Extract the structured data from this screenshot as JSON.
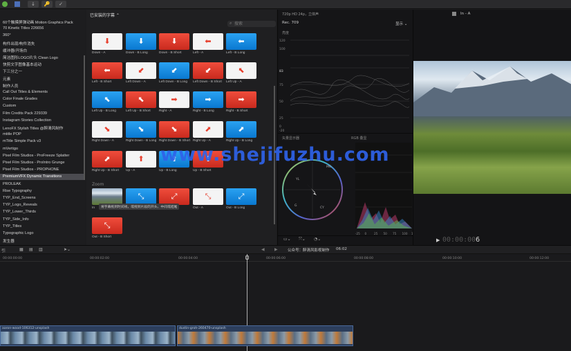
{
  "topbar": {
    "buttons": [
      "↓",
      "🔑",
      "✓"
    ]
  },
  "sidebar": {
    "items": [
      "60个触摸屏弹动画 Motion Graphics Pack",
      "70 Kinetic Titles 226656",
      "360°",
      "构件出现/构件消失",
      "缓冲器/开场白",
      "简洁图形LOGO片头 Clean Logo",
      "快剪文字图像基本运动",
      "下三分之一",
      "元素",
      "制作人员",
      "Call Out Titles & Elements",
      "Color Finale Grades",
      "Custom",
      "Film Credits Pack 229339",
      "Instagram Stories Collection",
      "LenoFX Stylish Titles @醉清风制作",
      "mtitle POP",
      "mTitle Simple Pack v3",
      "mVertigo",
      "Pixel Film Studios - ProFreeze Splatter",
      "Pixel Film Studios - ProIntro Grunge",
      "Pixel Film Studios - PROPHONE",
      "PremiumVFX Dynamic Transitions",
      "PROLEAK",
      "Rise Typography",
      "TYP_End_Screens",
      "TYP_Logo_Reveals",
      "TYP_Lower_Thirds",
      "TYP_Side_Info",
      "TYP_Titles",
      "Typographic Logo",
      "发生器"
    ],
    "selected_index": 22
  },
  "browser": {
    "header": "已安装的字幕 ⌃",
    "search_placeholder": "搜索",
    "section_zoom": "Zoom",
    "tooltip": "将字幕拖到时间线，或拖到片段的开头、中间或结尾",
    "items": [
      {
        "label": "Down - A",
        "style": "white",
        "glyph": "⬇",
        "gc": "#e8402e"
      },
      {
        "label": "Down - B Long",
        "style": "blue",
        "glyph": "⬇",
        "gc": "#fff"
      },
      {
        "label": "Down - B Short",
        "style": "red",
        "glyph": "⬇",
        "gc": "#fff"
      },
      {
        "label": "Left - A",
        "style": "white",
        "glyph": "⬅",
        "gc": "#e8402e"
      },
      {
        "label": "Left - B Long",
        "style": "blue",
        "glyph": "⬅",
        "gc": "#fff"
      },
      {
        "label": "Left - B Short",
        "style": "red",
        "glyph": "⬅",
        "gc": "#fff"
      },
      {
        "label": "Left Down - A",
        "style": "white",
        "glyph": "⬋",
        "gc": "#e8402e"
      },
      {
        "label": "Left Down - B Long",
        "style": "blue",
        "glyph": "⬋",
        "gc": "#fff"
      },
      {
        "label": "Left Down - B Short",
        "style": "red",
        "glyph": "⬋",
        "gc": "#fff"
      },
      {
        "label": "Left Up - A",
        "style": "white",
        "glyph": "⬉",
        "gc": "#e8402e"
      },
      {
        "label": "Left Up - B Long",
        "style": "blue",
        "glyph": "⬉",
        "gc": "#fff"
      },
      {
        "label": "Left Up - B Short",
        "style": "red",
        "glyph": "⬉",
        "gc": "#fff"
      },
      {
        "label": "Right - A",
        "style": "white",
        "glyph": "➡",
        "gc": "#e8402e"
      },
      {
        "label": "Right - B Long",
        "style": "blue",
        "glyph": "➡",
        "gc": "#fff"
      },
      {
        "label": "Right - B Short",
        "style": "red",
        "glyph": "➡",
        "gc": "#fff"
      },
      {
        "label": "Right Down - A",
        "style": "white",
        "glyph": "⬊",
        "gc": "#e8402e"
      },
      {
        "label": "Right Down - B Long",
        "style": "blue",
        "glyph": "⬊",
        "gc": "#fff"
      },
      {
        "label": "Right Down - B Short",
        "style": "red",
        "glyph": "⬊",
        "gc": "#fff"
      },
      {
        "label": "Right Up - A",
        "style": "white",
        "glyph": "⬈",
        "gc": "#e8402e"
      },
      {
        "label": "Right Up - B Long",
        "style": "blue",
        "glyph": "⬈",
        "gc": "#fff"
      },
      {
        "label": "Right Up - B Short",
        "style": "red",
        "glyph": "⬈",
        "gc": "#fff"
      },
      {
        "label": "Up - A",
        "style": "white",
        "glyph": "⬆",
        "gc": "#e8402e"
      },
      {
        "label": "Up - B Long",
        "style": "blue",
        "glyph": "⬆",
        "gc": "#fff"
      },
      {
        "label": "Up - B Short",
        "style": "red",
        "glyph": "⬆",
        "gc": "#fff"
      },
      {
        "label": "In",
        "style": "photo",
        "glyph": "",
        "gc": "#fff"
      },
      {
        "label": "",
        "style": "blue",
        "glyph": "⤡",
        "gc": "#fff"
      },
      {
        "label": "",
        "style": "red",
        "glyph": "⤢",
        "gc": "#fff"
      },
      {
        "label": "Out - A",
        "style": "white",
        "glyph": "⤡",
        "gc": "#e8402e"
      },
      {
        "label": "Out - B Long",
        "style": "blue",
        "glyph": "⤢",
        "gc": "#fff"
      },
      {
        "label": "Out - B Short",
        "style": "red",
        "glyph": "⤡",
        "gc": "#fff"
      }
    ]
  },
  "scopes": {
    "format": "720p HD 24p，立体声",
    "standard": "Rec. 709",
    "display_btn": "显示 ⌄",
    "luma_title": "亮度",
    "luma_ticks": [
      "120",
      "100",
      "83",
      "75",
      "50",
      "25",
      "0",
      "-20"
    ],
    "vectorscope_title": "矢量显示器",
    "rgb_title": "RGB 叠显",
    "rgb_ticks": [
      "-25",
      "0",
      "25",
      "50",
      "75",
      "100",
      "125"
    ]
  },
  "viewer": {
    "title": "In - A",
    "timecode": "00:00:00",
    "frame": "6"
  },
  "timeline": {
    "info": "公众号：醉清风影视制作",
    "duration": "06:02",
    "ruler": [
      "00:00:00:00",
      "00:00:02:00",
      "00:00:04:00",
      "00:00:06:00",
      "00:00:08:00",
      "00:00:10:00",
      "00:00:12:00"
    ],
    "clip1": "aaron-wood-106312-unsplash",
    "clip2": "dustin-groh-260470-unsplash"
  },
  "watermark": "www.shejifuzhu.com"
}
